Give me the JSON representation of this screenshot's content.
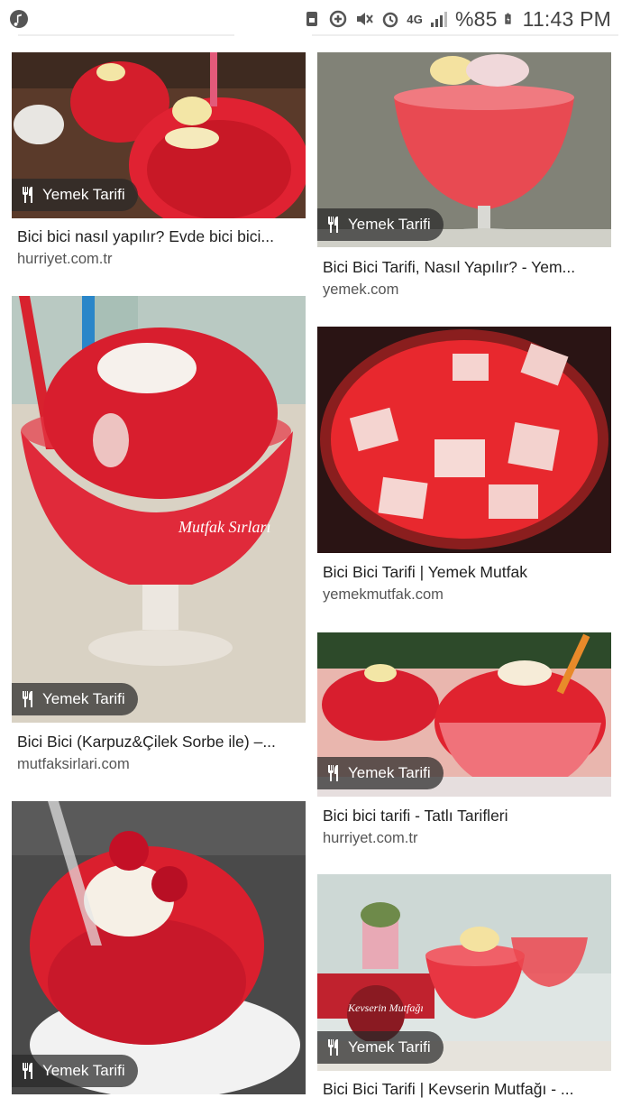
{
  "status_bar": {
    "battery_percent": "%85",
    "time": "11:43 PM",
    "network": "4G"
  },
  "badge_label": "Yemek Tarifi",
  "results": [
    {
      "title": "Bici bici nasıl yapılır? Evde bici bici...",
      "source": "hurriyet.com.tr"
    },
    {
      "title": "Bici Bici Tarifi, Nasıl Yapılır? - Yem...",
      "source": "yemek.com"
    },
    {
      "title": "Bici Bici (Karpuz&Çilek Sorbe ile) –...",
      "source": "mutfaksirlari.com"
    },
    {
      "title": "Bici Bici Tarifi | Yemek Mutfak",
      "source": "yemekmutfak.com"
    },
    {
      "title": "Bici bici tarifi - Tatlı Tarifleri",
      "source": "hurriyet.com.tr"
    },
    {
      "title": "Bici Bici Tarifi | Kevserin Mutfağı - ...",
      "source": ""
    }
  ],
  "watermarks": {
    "mutfak": "Mutfak Sırları",
    "kevserin": "Kevserin Mutfağı"
  }
}
